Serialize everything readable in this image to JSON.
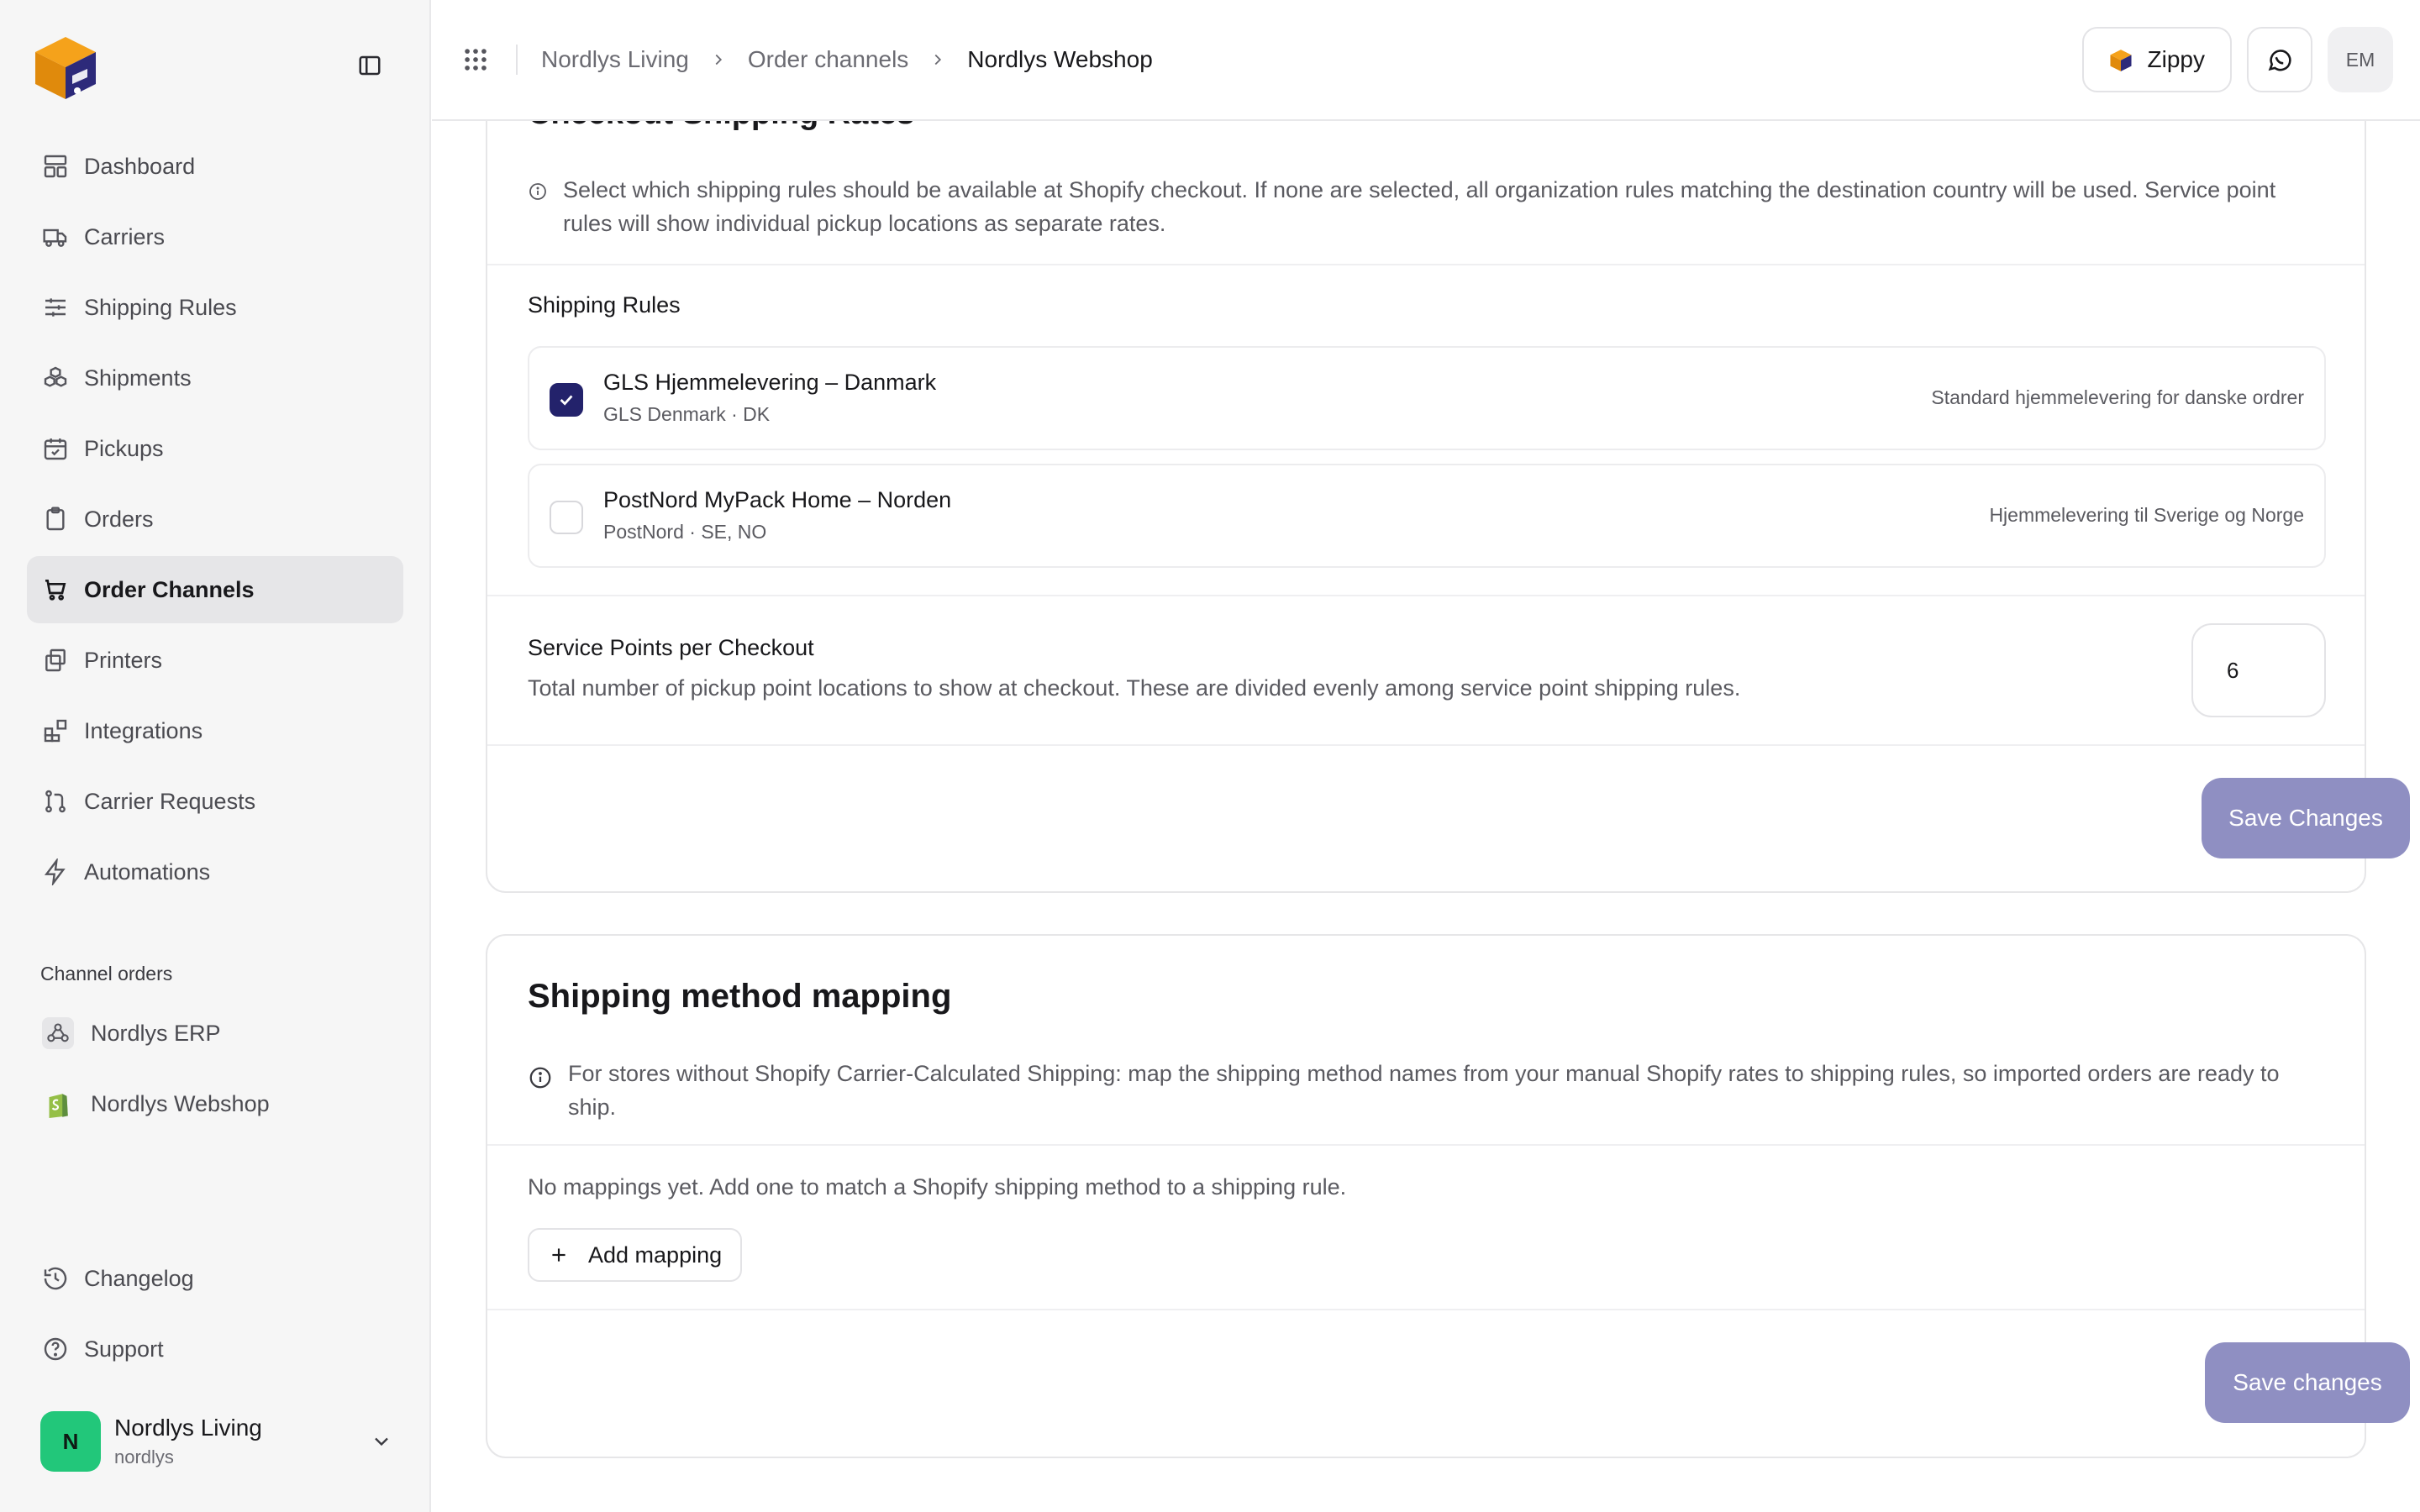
{
  "sidebar": {
    "nav": [
      {
        "label": "Dashboard",
        "icon": "dashboard-icon"
      },
      {
        "label": "Carriers",
        "icon": "truck-icon"
      },
      {
        "label": "Shipping Rules",
        "icon": "sliders-icon"
      },
      {
        "label": "Shipments",
        "icon": "boxes-icon"
      },
      {
        "label": "Pickups",
        "icon": "calendar-check-icon"
      },
      {
        "label": "Orders",
        "icon": "clipboard-icon"
      },
      {
        "label": "Order Channels",
        "icon": "cart-icon",
        "active": true
      },
      {
        "label": "Printers",
        "icon": "printer-icon"
      },
      {
        "label": "Integrations",
        "icon": "blocks-icon"
      },
      {
        "label": "Carrier Requests",
        "icon": "git-pull-icon"
      },
      {
        "label": "Automations",
        "icon": "lightning-icon"
      }
    ],
    "section_label": "Channel orders",
    "channels": [
      {
        "label": "Nordlys ERP",
        "icon": "webhook-icon"
      },
      {
        "label": "Nordlys Webshop",
        "icon": "shopify-icon"
      }
    ],
    "bottom": [
      {
        "label": "Changelog",
        "icon": "history-icon"
      },
      {
        "label": "Support",
        "icon": "help-circle-icon"
      }
    ],
    "account": {
      "initial": "N",
      "name": "Nordlys Living",
      "handle": "nordlys"
    }
  },
  "topbar": {
    "breadcrumbs": [
      "Nordlys Living",
      "Order channels",
      "Nordlys Webshop"
    ],
    "zippy_label": "Zippy",
    "user_initials": "EM"
  },
  "checkout_card": {
    "title": "Checkout Shipping Rates",
    "info": "Select which shipping rules should be available at Shopify checkout. If none are selected, all organization rules matching the destination country will be used. Service point rules will show individual pickup locations as separate rates.",
    "rules_label": "Shipping Rules",
    "rules": [
      {
        "name": "GLS Hjemmelevering – Danmark",
        "sub": "GLS Denmark · DK",
        "desc": "Standard hjemmelevering for danske ordrer",
        "checked": true
      },
      {
        "name": "PostNord MyPack Home – Norden",
        "sub": "PostNord · SE, NO",
        "desc": "Hjemmelevering til Sverige og Norge",
        "checked": false
      }
    ],
    "service_points_label": "Service Points per Checkout",
    "service_points_desc": "Total number of pickup point locations to show at checkout. These are divided evenly among service point shipping rules.",
    "service_points_value": "6",
    "save_label": "Save Changes"
  },
  "mapping_card": {
    "title": "Shipping method mapping",
    "info": "For stores without Shopify Carrier-Calculated Shipping: map the shipping method names from your manual Shopify rates to shipping rules, so imported orders are ready to ship.",
    "empty": "No mappings yet. Add one to match a Shopify shipping method to a shipping rule.",
    "add_label": "Add mapping",
    "save_label": "Save changes"
  },
  "colors": {
    "accent": "#23226b",
    "save_button": "#8f8fc2",
    "avatar": "#22c77a",
    "logo_orange": "#f5a21b",
    "logo_indigo": "#2d2a7a"
  }
}
